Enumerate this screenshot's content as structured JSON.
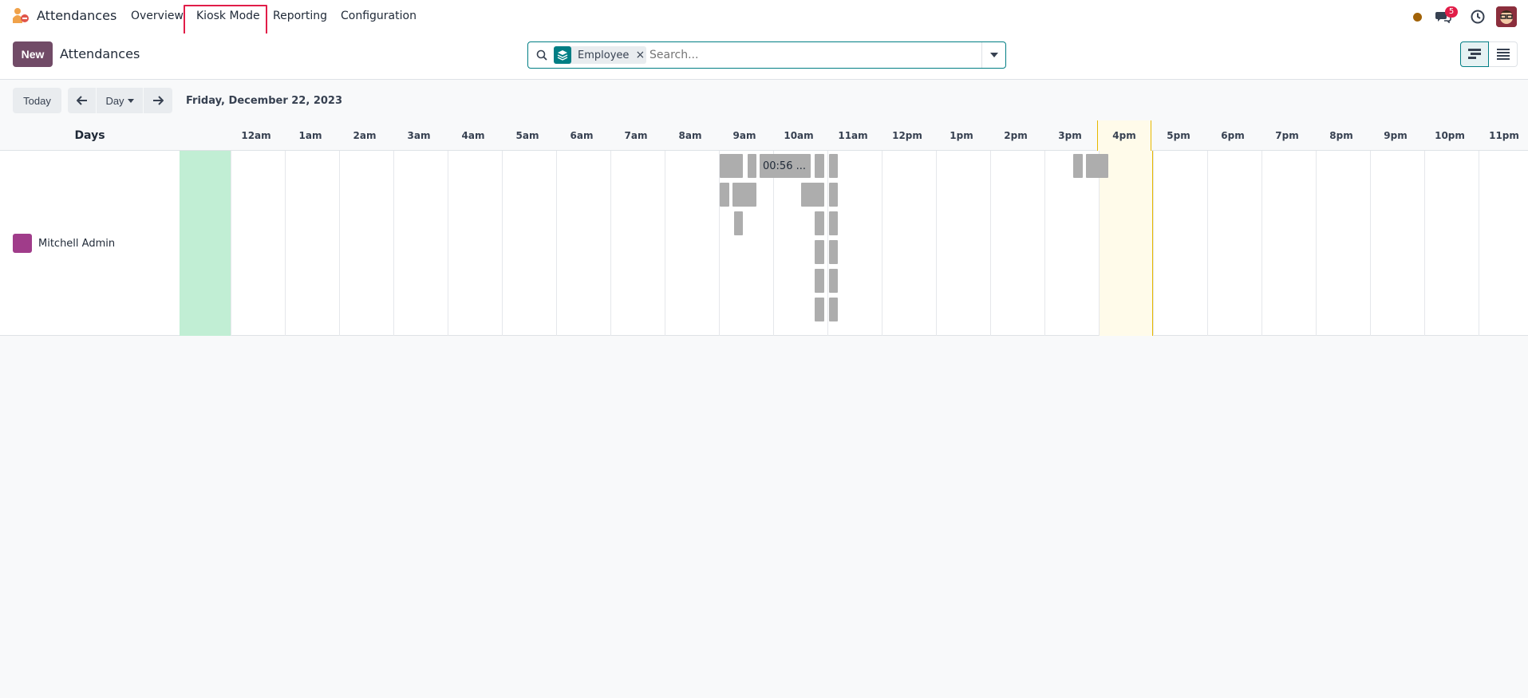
{
  "app": {
    "name": "Attendances"
  },
  "menu": [
    {
      "label": "Overview"
    },
    {
      "label": "Kiosk Mode"
    },
    {
      "label": "Reporting"
    },
    {
      "label": "Configuration"
    }
  ],
  "tray": {
    "messages_badge": "5"
  },
  "control": {
    "new_label": "New",
    "breadcrumb": "Attendances",
    "facet_label": "Employee",
    "facet_remove": "×",
    "search_placeholder": "Search..."
  },
  "datenav": {
    "today_label": "Today",
    "scale_label": "Day",
    "date": "Friday, December 22, 2023"
  },
  "gantt": {
    "header_label": "Days",
    "hours": [
      "12am",
      "1am",
      "2am",
      "3am",
      "4am",
      "5am",
      "6am",
      "7am",
      "8am",
      "9am",
      "10am",
      "11am",
      "12pm",
      "1pm",
      "2pm",
      "3pm",
      "4pm",
      "5pm",
      "6pm",
      "7pm",
      "8pm",
      "9pm",
      "10pm",
      "11pm"
    ],
    "current_hour": "4pm",
    "rows": [
      {
        "name": "Mitchell Admin"
      }
    ],
    "pill_text": "00:56 ..."
  },
  "colors": {
    "brand": "#714b67",
    "accent": "#017e84",
    "pill": "#adadad",
    "today_cell": "#c1eed4",
    "now_cell": "#fffbea",
    "highlight_box": "#e11d48"
  }
}
